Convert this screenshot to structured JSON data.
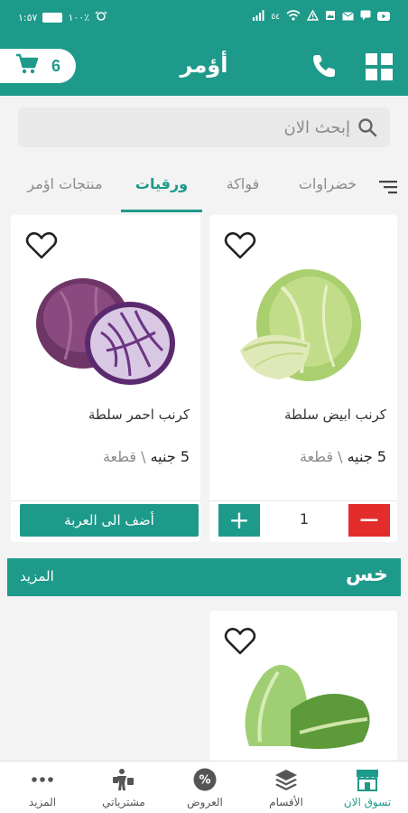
{
  "status_bar": {
    "time": "١:٥٧",
    "network_speed": "٥٤",
    "battery_text": "١٠٠٪"
  },
  "app_bar": {
    "title": "أؤمر",
    "cart_count": "6"
  },
  "search": {
    "placeholder": "إبحث الان"
  },
  "tabs": [
    {
      "label": "خضراوات",
      "active": false
    },
    {
      "label": "فواكة",
      "active": false
    },
    {
      "label": "ورقيات",
      "active": true
    },
    {
      "label": "منتجات اؤمر",
      "active": false
    }
  ],
  "products": [
    {
      "name": "كرنب ابيض سلطة",
      "price": "5 جنيه",
      "unit": "\\ قطعة",
      "quantity": "1"
    },
    {
      "name": "كرنب احمر سلطة",
      "price": "5 جنيه",
      "unit": "\\ قطعة",
      "button_label": "أضف الى العربة"
    }
  ],
  "section": {
    "title": "خس",
    "more_label": "المزيد"
  },
  "bottom_nav": [
    {
      "label": "تسوق الان",
      "icon": "shop-icon",
      "active": true
    },
    {
      "label": "الأقسام",
      "icon": "layers-icon",
      "active": false
    },
    {
      "label": "العروض",
      "icon": "discount-badge-icon",
      "active": false
    },
    {
      "label": "مشترياتي",
      "icon": "purchases-icon",
      "active": false
    },
    {
      "label": "المزيد",
      "icon": "more-dots-icon",
      "active": false
    }
  ],
  "colors": {
    "primary": "#1e9a8a",
    "danger": "#e32c2c"
  }
}
